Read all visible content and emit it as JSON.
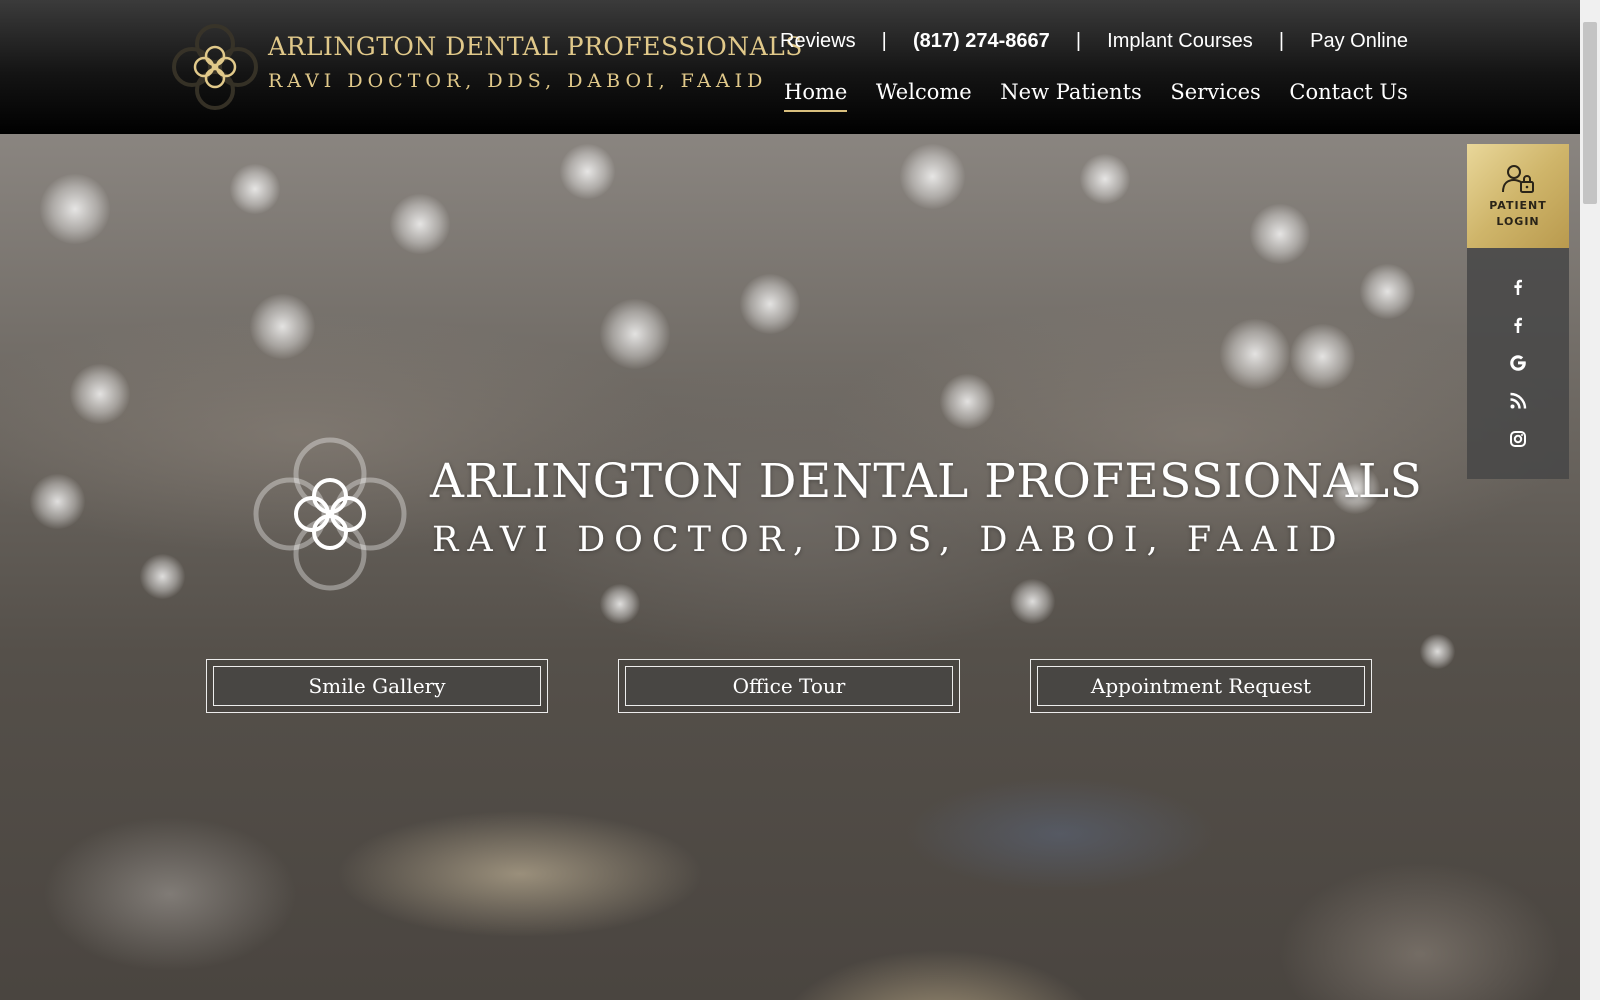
{
  "header": {
    "logo_name": "ARLINGTON DENTAL PROFESSIONALS",
    "logo_credentials": "RAVI DOCTOR, DDS, DABOI, FAAID",
    "utility_links": {
      "reviews": "Reviews",
      "phone": "(817) 274-8667",
      "implant_courses": "Implant Courses",
      "pay_online": "Pay Online",
      "separator": "|"
    },
    "nav": {
      "home": "Home",
      "welcome": "Welcome",
      "new_patients": "New Patients",
      "services": "Services",
      "contact_us": "Contact Us",
      "active": "Home"
    }
  },
  "hero": {
    "name": "ARLINGTON DENTAL PROFESSIONALS",
    "credentials": "RAVI DOCTOR, DDS, DABOI, FAAID",
    "buttons": {
      "smile_gallery": "Smile Gallery",
      "office_tour": "Office Tour",
      "appointment_request": "Appointment Request"
    }
  },
  "side_panel": {
    "login_label_line1": "PATIENT",
    "login_label_line2": "LOGIN",
    "social_icons": [
      "facebook-icon",
      "facebook-icon",
      "google-icon",
      "rss-icon",
      "instagram-icon"
    ]
  },
  "colors": {
    "gold": "#e1c98a",
    "nav_underline": "#d9bf7e",
    "header_bg": "#000000",
    "login_gold": "#cfb56a"
  }
}
